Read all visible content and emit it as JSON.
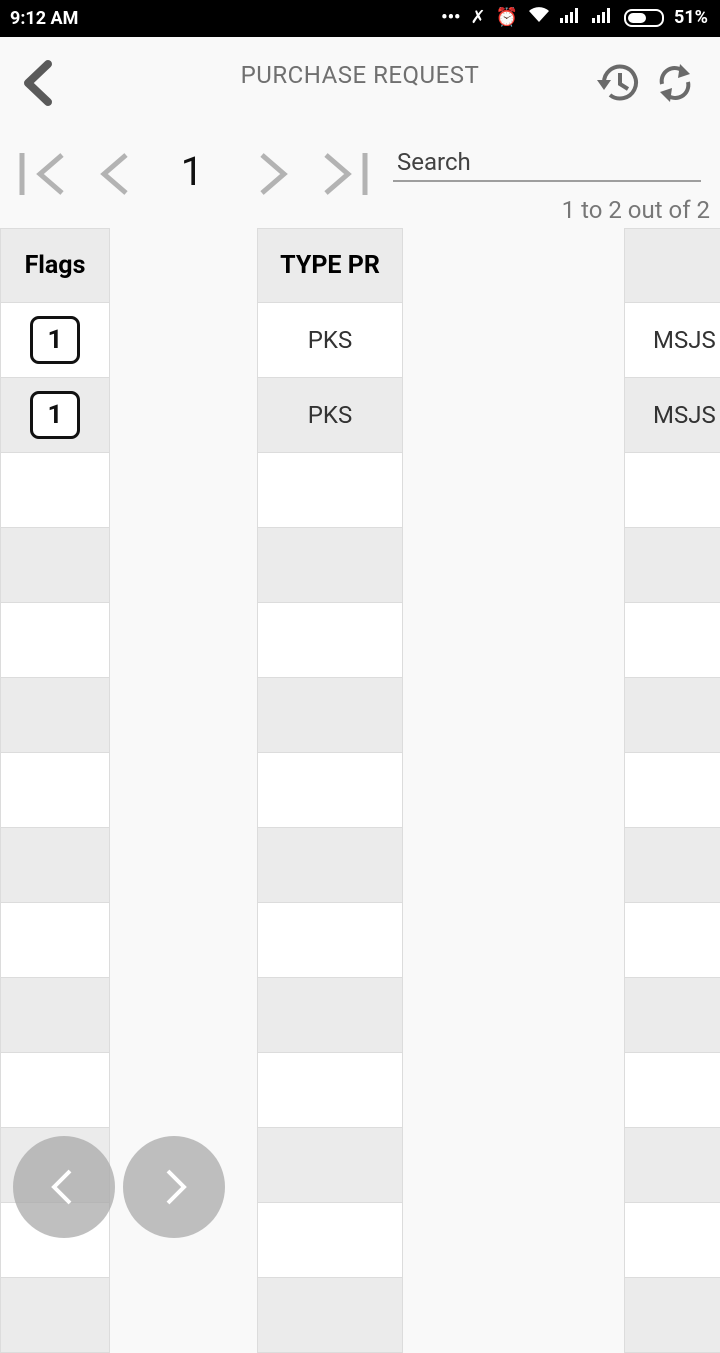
{
  "status_bar": {
    "time": "9:12 AM",
    "battery_percent": "51%"
  },
  "header": {
    "title": "PURCHASE REQUEST"
  },
  "pagination": {
    "current_page": "1"
  },
  "search": {
    "placeholder": "Search",
    "value": ""
  },
  "results": {
    "range_text": "1 to 2 out of 2"
  },
  "table": {
    "columns": [
      "Flags",
      "TYPE PR",
      ""
    ],
    "rows": [
      {
        "flag": "1",
        "type_pr": "PKS",
        "third": "MSJS"
      },
      {
        "flag": "1",
        "type_pr": "PKS",
        "third": "MSJS"
      }
    ]
  }
}
